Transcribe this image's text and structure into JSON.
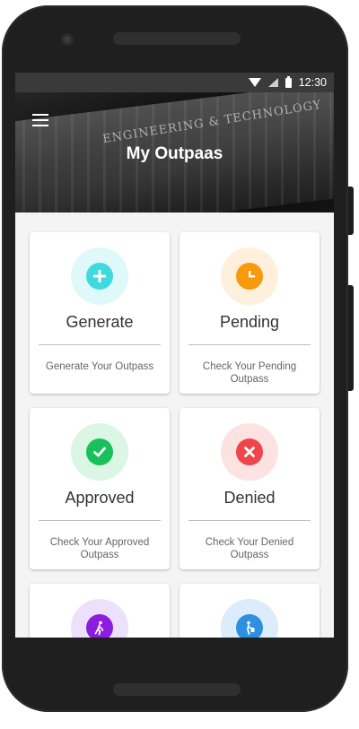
{
  "status_bar": {
    "time": "12:30"
  },
  "header": {
    "title": "My Outpaas",
    "building_text": "ENGINEERING & TECHNOLOGY"
  },
  "cards": [
    {
      "title": "Generate",
      "subtitle": "Generate Your Outpass",
      "icon": "plus-icon",
      "color": "#40d9e0",
      "bg": "#dff8fa"
    },
    {
      "title": "Pending",
      "subtitle": "Check Your Pending Outpass",
      "icon": "clock-icon",
      "color": "#f79a0e",
      "bg": "#fff0de"
    },
    {
      "title": "Approved",
      "subtitle": "Check Your Approved Outpass",
      "icon": "check-icon",
      "color": "#19c15a",
      "bg": "#dbf6e4"
    },
    {
      "title": "Denied",
      "subtitle": "Check Your Denied Outpass",
      "icon": "close-icon",
      "color": "#f0454a",
      "bg": "#fde2e2"
    },
    {
      "title": "",
      "subtitle": "",
      "icon": "walking-person-icon",
      "color": "#8c1de0",
      "bg": "#ece0fb"
    },
    {
      "title": "",
      "subtitle": "",
      "icon": "traveler-luggage-icon",
      "color": "#2f8fe0",
      "bg": "#dcecfb"
    }
  ]
}
